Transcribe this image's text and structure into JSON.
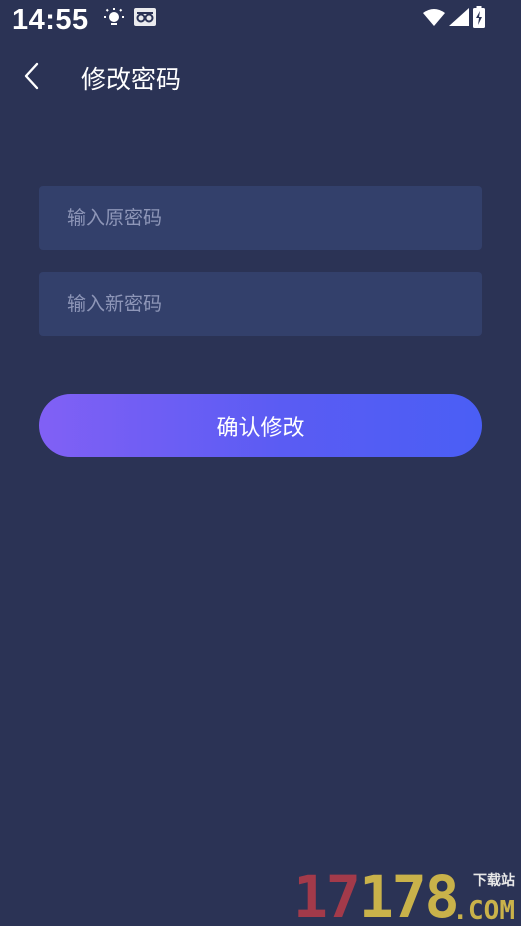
{
  "status_bar": {
    "time": "14:55",
    "left_icons": [
      "weather-sun-icon",
      "app-notification-icon"
    ],
    "right_icons": [
      "wifi-icon",
      "signal-icon",
      "battery-charging-icon"
    ]
  },
  "header": {
    "back_icon": "chevron-left-icon",
    "title": "修改密码"
  },
  "form": {
    "old_password_placeholder": "输入原密码",
    "old_password_value": "",
    "new_password_placeholder": "输入新密码",
    "new_password_value": "",
    "confirm_label": "确认修改"
  },
  "watermark": {
    "number_part1": "17",
    "number_part2": "178",
    "sub": "下载站",
    "domain": ".COM"
  },
  "colors": {
    "background": "#2b3355",
    "input_background": "#33406b",
    "placeholder": "#8e96b8",
    "button_gradient_start": "#8160f5",
    "button_gradient_end": "#4a5ef5"
  }
}
